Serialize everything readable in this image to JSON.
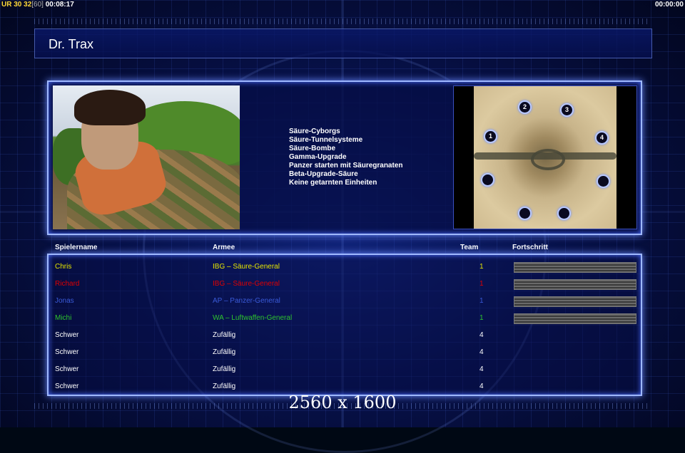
{
  "hud": {
    "ur_label": "UR",
    "num1": "30",
    "num2": "32",
    "fps": "[60]",
    "elapsed": "00:08:17",
    "clock": "00:00:00"
  },
  "header": {
    "title": "Dr. Trax"
  },
  "general": {
    "features": [
      "Säure-Cyborgs",
      "Säure-Tunnelsysteme",
      "Säure-Bombe",
      "Gamma-Upgrade",
      "Panzer starten mit Säuregranaten",
      "Beta-Upgrade-Säure",
      "Keine getarnten Einheiten"
    ]
  },
  "map": {
    "slots": [
      "1",
      "2",
      "3",
      "4",
      "",
      "",
      "",
      ""
    ]
  },
  "table": {
    "headers": {
      "name": "Spielername",
      "army": "Armee",
      "team": "Team",
      "progress": "Fortschritt"
    },
    "rows": [
      {
        "name": "Chris",
        "army": "IBG – Säure-General",
        "team": "1",
        "color": "#e6e600",
        "progress": 1.0
      },
      {
        "name": "Richard",
        "army": "IBG – Säure-General",
        "team": "1",
        "color": "#e00000",
        "progress": 1.0
      },
      {
        "name": "Jonas",
        "army": "AP – Panzer-General",
        "team": "1",
        "color": "#3a5ad8",
        "progress": 1.0
      },
      {
        "name": "Michi",
        "army": "WA – Luftwaffen-General",
        "team": "1",
        "color": "#2ec42e",
        "progress": 1.0
      },
      {
        "name": "Schwer",
        "army": "Zufällig",
        "team": "4",
        "color": "#ffffff",
        "progress": null
      },
      {
        "name": "Schwer",
        "army": "Zufällig",
        "team": "4",
        "color": "#ffffff",
        "progress": null
      },
      {
        "name": "Schwer",
        "army": "Zufällig",
        "team": "4",
        "color": "#ffffff",
        "progress": null
      },
      {
        "name": "Schwer",
        "army": "Zufällig",
        "team": "4",
        "color": "#ffffff",
        "progress": null
      }
    ]
  },
  "overlay": {
    "resolution": "2560 x 1600"
  }
}
